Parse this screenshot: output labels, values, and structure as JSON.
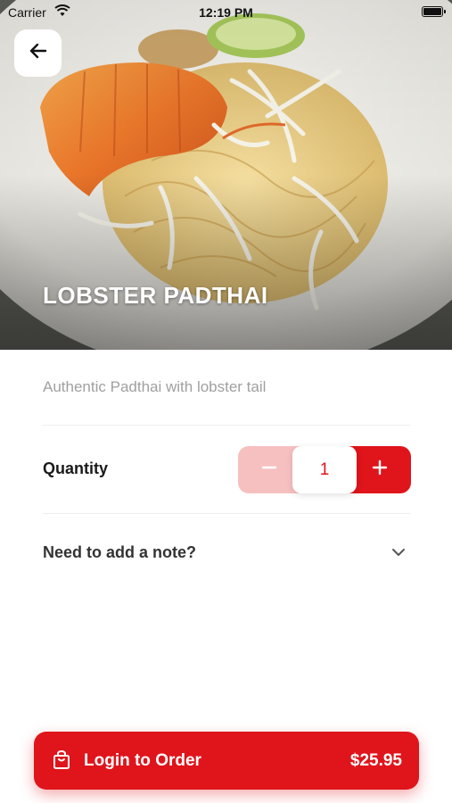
{
  "status_bar": {
    "carrier": "Carrier",
    "time": "12:19 PM"
  },
  "item": {
    "title": "LOBSTER PADTHAI",
    "description": "Authentic Padthai with lobster tail"
  },
  "quantity": {
    "label": "Quantity",
    "value": "1"
  },
  "note": {
    "label": "Need to add a note?"
  },
  "cta": {
    "label": "Login to Order",
    "price": "$25.95"
  },
  "colors": {
    "accent": "#e0141b",
    "accent_light": "#f7c0c0"
  },
  "icons": [
    "wifi-icon",
    "battery-icon",
    "back-arrow-icon",
    "minus-icon",
    "plus-icon",
    "chevron-down-icon",
    "shopping-bag-icon"
  ]
}
